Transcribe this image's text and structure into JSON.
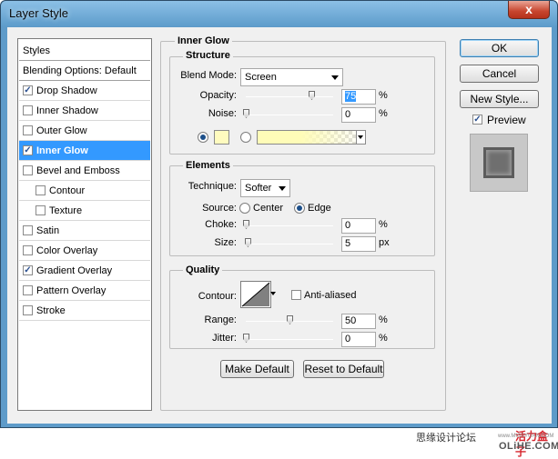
{
  "window": {
    "title": "Layer Style",
    "close": "x"
  },
  "left_list": {
    "items": [
      {
        "label": "Styles",
        "checkbox": false,
        "checked": false,
        "indent": false,
        "selected": false,
        "header": true
      },
      {
        "label": "Blending Options: Default",
        "checkbox": false,
        "checked": false,
        "indent": false,
        "selected": false,
        "header": true
      },
      {
        "label": "Drop Shadow",
        "checkbox": true,
        "checked": true,
        "indent": false,
        "selected": false
      },
      {
        "label": "Inner Shadow",
        "checkbox": true,
        "checked": false,
        "indent": false,
        "selected": false
      },
      {
        "label": "Outer Glow",
        "checkbox": true,
        "checked": false,
        "indent": false,
        "selected": false
      },
      {
        "label": "Inner Glow",
        "checkbox": true,
        "checked": true,
        "indent": false,
        "selected": true
      },
      {
        "label": "Bevel and Emboss",
        "checkbox": true,
        "checked": false,
        "indent": false,
        "selected": false
      },
      {
        "label": "Contour",
        "checkbox": true,
        "checked": false,
        "indent": true,
        "selected": false
      },
      {
        "label": "Texture",
        "checkbox": true,
        "checked": false,
        "indent": true,
        "selected": false
      },
      {
        "label": "Satin",
        "checkbox": true,
        "checked": false,
        "indent": false,
        "selected": false
      },
      {
        "label": "Color Overlay",
        "checkbox": true,
        "checked": false,
        "indent": false,
        "selected": false
      },
      {
        "label": "Gradient Overlay",
        "checkbox": true,
        "checked": true,
        "indent": false,
        "selected": false
      },
      {
        "label": "Pattern Overlay",
        "checkbox": true,
        "checked": false,
        "indent": false,
        "selected": false
      },
      {
        "label": "Stroke",
        "checkbox": true,
        "checked": false,
        "indent": false,
        "selected": false
      }
    ]
  },
  "panel": {
    "title": "Inner Glow",
    "structure": {
      "title": "Structure",
      "blend_mode_label": "Blend Mode:",
      "blend_mode_value": "Screen",
      "opacity_label": "Opacity:",
      "opacity_value": "75",
      "opacity_fraction": 0.75,
      "noise_label": "Noise:",
      "noise_value": "0",
      "noise_fraction": 0.0,
      "percent": "%",
      "color_selected": "solid",
      "color_swatch": "#fffbbf"
    },
    "elements": {
      "title": "Elements",
      "technique_label": "Technique:",
      "technique_value": "Softer",
      "source_label": "Source:",
      "source_center": "Center",
      "source_edge": "Edge",
      "source_selected": "edge",
      "choke_label": "Choke:",
      "choke_value": "0",
      "choke_fraction": 0.0,
      "size_label": "Size:",
      "size_value": "5",
      "size_fraction": 0.02,
      "percent": "%",
      "px": "px"
    },
    "quality": {
      "title": "Quality",
      "contour_label": "Contour:",
      "anti_aliased_label": "Anti-aliased",
      "anti_aliased_checked": false,
      "range_label": "Range:",
      "range_value": "50",
      "range_fraction": 0.5,
      "jitter_label": "Jitter:",
      "jitter_value": "0",
      "jitter_fraction": 0.0,
      "percent": "%"
    },
    "make_default": "Make Default",
    "reset_default": "Reset to Default"
  },
  "right": {
    "ok": "OK",
    "cancel": "Cancel",
    "new_style": "New Style...",
    "preview_label": "Preview",
    "preview_checked": true
  },
  "watermark": {
    "site_cn": "思缘设计论坛",
    "site_small": "www.MISSYUAN.COM",
    "brand_cn": "活力盒子",
    "brand_en": "OLiHE.COM"
  }
}
